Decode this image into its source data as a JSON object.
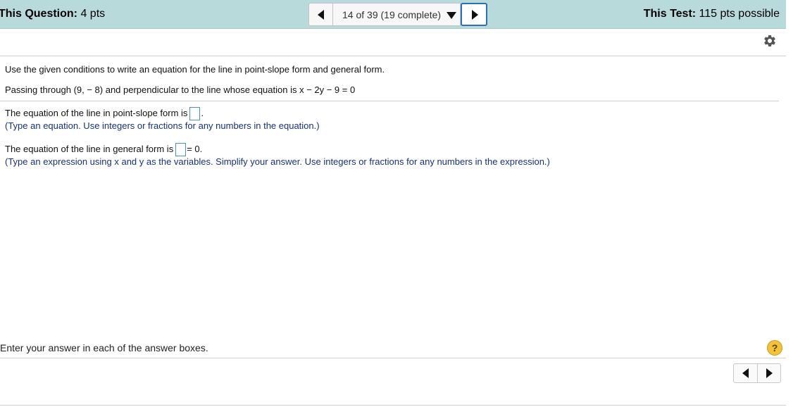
{
  "header": {
    "question_label": "This Question:",
    "question_value": " 4 pts",
    "nav_label": "14 of 39 (19 complete)",
    "test_label": "This Test:",
    "test_value": " 115 pts possible"
  },
  "question": {
    "instruction": "Use the given conditions to write an equation for the line in point-slope form and general form.",
    "given": "Passing through (9, − 8) and perpendicular to the line whose equation is x − 2y − 9 = 0"
  },
  "part1": {
    "prefix": "The equation of the line in point-slope form is",
    "suffix": ".",
    "hint": "(Type an equation. Use integers or fractions for any numbers in the equation.)"
  },
  "part2": {
    "prefix": "The equation of the line in general form is",
    "suffix": "= 0.",
    "hint": "(Type an expression using x and y as the variables. Simplify your answer. Use integers or fractions for any numbers in the expression.)"
  },
  "footer": {
    "instruction": "Enter your answer in each of the answer boxes.",
    "help_symbol": "?"
  },
  "icons": {
    "gear": "gear-icon",
    "help": "help-icon",
    "prev": "triangle-left-icon",
    "next": "triangle-right-icon",
    "dropdown": "triangle-down-icon"
  },
  "colors": {
    "header_bg": "#b8dadb",
    "hint_text": "#17317a",
    "answer_box_border": "#4a8fcf",
    "help_icon": "#f2c23a"
  }
}
